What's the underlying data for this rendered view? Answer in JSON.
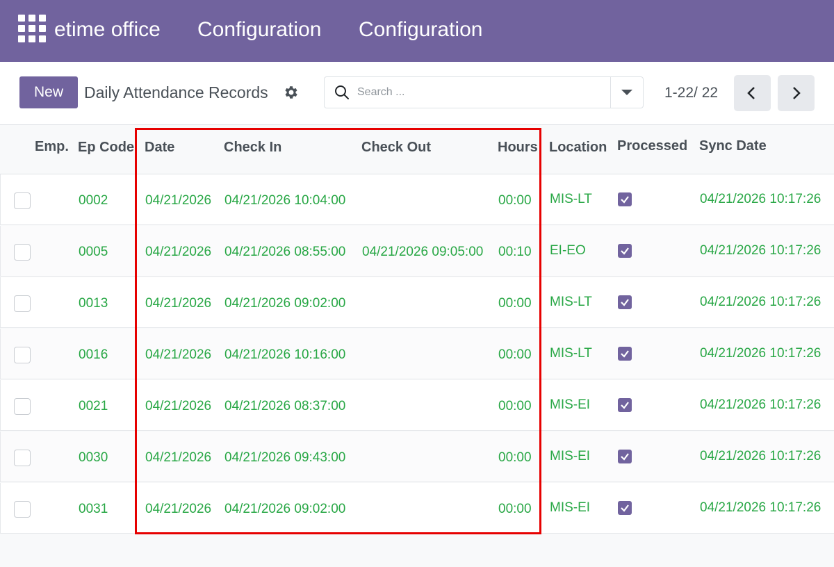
{
  "navbar": {
    "brand": "etime office",
    "menus": [
      "Configuration",
      "Configuration"
    ],
    "bg_color": "#71639e",
    "apps_icon": "grid-apps-icon"
  },
  "control_panel": {
    "new_label": "New",
    "title": "Daily Attendance Records",
    "settings_icon": "gear-icon",
    "search_placeholder": "Search ...",
    "pager": "1-22/ 22"
  },
  "table": {
    "columns": {
      "emp": "Emp.",
      "ep_code": "Ep Code",
      "date": "Date",
      "check_in": "Check In",
      "check_out": "Check Out",
      "hours": "Hours",
      "location": "Location",
      "processed": "Processed",
      "sync_date": "Sync Date"
    },
    "rows": [
      {
        "ep_code": "0002",
        "date": "04/21/2026",
        "check_in": "04/21/2026 10:04:00",
        "check_out": "",
        "hours": "00:00",
        "location": "MIS-LT",
        "processed": true,
        "sync_date": "04/21/2026 10:17:26"
      },
      {
        "ep_code": "0005",
        "date": "04/21/2026",
        "check_in": "04/21/2026 08:55:00",
        "check_out": "04/21/2026 09:05:00",
        "hours": "00:10",
        "location": "EI-EO",
        "processed": true,
        "sync_date": "04/21/2026 10:17:26"
      },
      {
        "ep_code": "0013",
        "date": "04/21/2026",
        "check_in": "04/21/2026 09:02:00",
        "check_out": "",
        "hours": "00:00",
        "location": "MIS-LT",
        "processed": true,
        "sync_date": "04/21/2026 10:17:26"
      },
      {
        "ep_code": "0016",
        "date": "04/21/2026",
        "check_in": "04/21/2026 10:16:00",
        "check_out": "",
        "hours": "00:00",
        "location": "MIS-LT",
        "processed": true,
        "sync_date": "04/21/2026 10:17:26"
      },
      {
        "ep_code": "0021",
        "date": "04/21/2026",
        "check_in": "04/21/2026 08:37:00",
        "check_out": "",
        "hours": "00:00",
        "location": "MIS-EI",
        "processed": true,
        "sync_date": "04/21/2026 10:17:26"
      },
      {
        "ep_code": "0030",
        "date": "04/21/2026",
        "check_in": "04/21/2026 09:43:00",
        "check_out": "",
        "hours": "00:00",
        "location": "MIS-EI",
        "processed": true,
        "sync_date": "04/21/2026 10:17:26"
      },
      {
        "ep_code": "0031",
        "date": "04/21/2026",
        "check_in": "04/21/2026 09:02:00",
        "check_out": "",
        "hours": "00:00",
        "location": "MIS-EI",
        "processed": true,
        "sync_date": "04/21/2026 10:17:26"
      }
    ],
    "value_color": "#28a745"
  }
}
